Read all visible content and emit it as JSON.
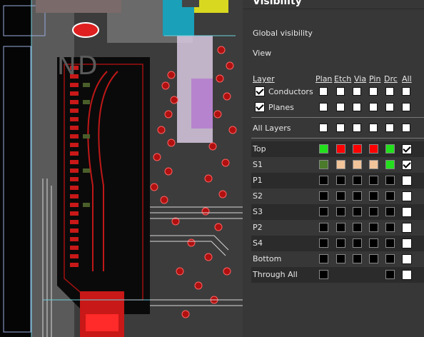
{
  "canvas": {
    "gnd_label": "GND"
  },
  "panel": {
    "title": "Visibility",
    "global_visibility": "Global visibility",
    "view": "View",
    "columns": [
      "Layer",
      "Plan",
      "Etch",
      "Via",
      "Pin",
      "Drc",
      "All"
    ],
    "groups": [
      {
        "label": "Conductors",
        "checked": true
      },
      {
        "label": "Planes",
        "checked": true
      }
    ],
    "all_layers_label": "All Layers",
    "layers": [
      {
        "label": "Top",
        "swatches": [
          "#22e01c",
          "#ff0000",
          "#ff0000",
          "#ff0000",
          "#22e01c"
        ],
        "all": true
      },
      {
        "label": "S1",
        "swatches": [
          "#4a7a2a",
          "#f2c49a",
          "#f2c49a",
          "#f2c49a",
          "#22e01c"
        ],
        "all": true
      },
      {
        "label": "P1",
        "swatches": [
          "#000000",
          "#000000",
          "#000000",
          "#000000",
          "#000000"
        ],
        "all": false
      },
      {
        "label": "S2",
        "swatches": [
          "#000000",
          "#000000",
          "#000000",
          "#000000",
          "#000000"
        ],
        "all": false
      },
      {
        "label": "S3",
        "swatches": [
          "#000000",
          "#000000",
          "#000000",
          "#000000",
          "#000000"
        ],
        "all": false
      },
      {
        "label": "P2",
        "swatches": [
          "#000000",
          "#000000",
          "#000000",
          "#000000",
          "#000000"
        ],
        "all": false
      },
      {
        "label": "S4",
        "swatches": [
          "#000000",
          "#000000",
          "#000000",
          "#000000",
          "#000000"
        ],
        "all": false
      },
      {
        "label": "Bottom",
        "swatches": [
          "#000000",
          "#000000",
          "#000000",
          "#000000",
          "#000000"
        ],
        "all": false
      },
      {
        "label": "Through All",
        "swatches": [
          "#000000",
          null,
          null,
          null,
          "#000000"
        ],
        "all": false
      }
    ]
  }
}
